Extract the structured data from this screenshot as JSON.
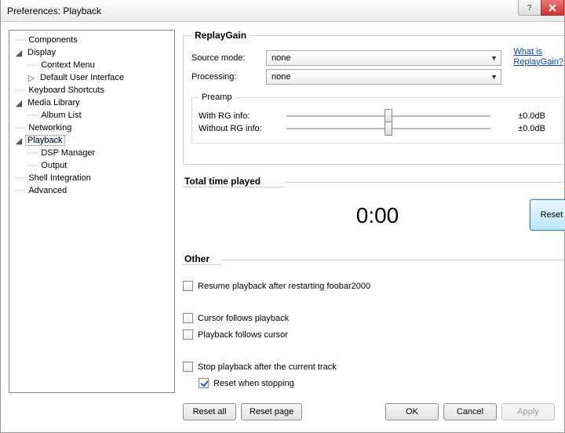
{
  "window": {
    "title": "Preferences: Playback"
  },
  "help_link": {
    "line1": "What is",
    "line2": "ReplayGain?"
  },
  "tree": {
    "components": "Components",
    "display": "Display",
    "context_menu": "Context Menu",
    "default_ui": "Default User Interface",
    "kbd": "Keyboard Shortcuts",
    "media_lib": "Media Library",
    "album_list": "Album List",
    "networking": "Networking",
    "playback": "Playback",
    "dsp": "DSP Manager",
    "output": "Output",
    "shell": "Shell Integration",
    "advanced": "Advanced"
  },
  "replaygain": {
    "legend": "ReplayGain",
    "source_label": "Source mode:",
    "source_value": "none",
    "processing_label": "Processing:",
    "processing_value": "none",
    "preamp_legend": "Preamp",
    "with_label": "With RG info:",
    "with_value": "±0.0dB",
    "without_label": "Without RG info:",
    "without_value": "±0.0dB"
  },
  "time": {
    "legend": "Total time played",
    "value": "0:00",
    "reset": "Reset"
  },
  "other": {
    "legend": "Other",
    "resume": "Resume playback after restarting foobar2000",
    "cursor_follows": "Cursor follows playback",
    "playback_follows": "Playback follows cursor",
    "stop_after": "Stop playback after the current track",
    "reset_when_stopping": "Reset when stopping"
  },
  "buttons": {
    "reset_all": "Reset all",
    "reset_page": "Reset page",
    "ok": "OK",
    "cancel": "Cancel",
    "apply": "Apply"
  }
}
